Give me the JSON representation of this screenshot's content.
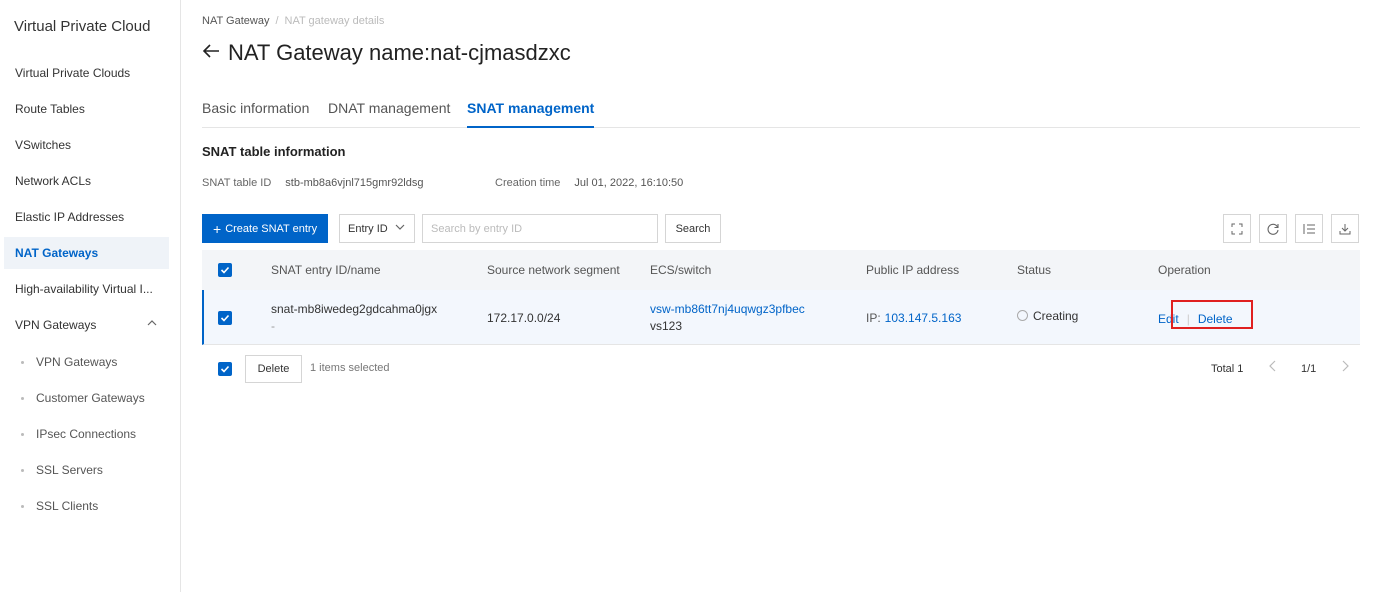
{
  "sidebar": {
    "title": "Virtual Private Cloud",
    "items": [
      {
        "label": "Virtual Private Clouds"
      },
      {
        "label": "Route Tables"
      },
      {
        "label": "VSwitches"
      },
      {
        "label": "Network ACLs"
      },
      {
        "label": "Elastic IP Addresses"
      },
      {
        "label": "NAT Gateways",
        "active": true
      },
      {
        "label": "High-availability Virtual I..."
      },
      {
        "label": "VPN Gateways",
        "expanded": true
      }
    ],
    "sub_items": [
      {
        "label": "VPN Gateways"
      },
      {
        "label": "Customer Gateways"
      },
      {
        "label": "IPsec Connections"
      },
      {
        "label": "SSL Servers"
      },
      {
        "label": "SSL Clients"
      }
    ]
  },
  "breadcrumb": {
    "parent": "NAT Gateway",
    "separator": "/",
    "current": "NAT gateway details"
  },
  "page": {
    "title": "NAT Gateway name:nat-cjmasdzxc"
  },
  "tabs": [
    {
      "label": "Basic information"
    },
    {
      "label": "DNAT management"
    },
    {
      "label": "SNAT management",
      "active": true
    }
  ],
  "snat": {
    "section_title": "SNAT table information",
    "table_id_label": "SNAT table ID",
    "table_id_value": "stb-mb8a6vjnl715gmr92ldsg",
    "creation_time_label": "Creation time",
    "creation_time_value": "Jul 01, 2022, 16:10:50"
  },
  "toolbar": {
    "create_label": "Create SNAT entry",
    "filter_select": "Entry ID",
    "search_placeholder": "Search by entry ID",
    "search_button": "Search"
  },
  "table": {
    "columns": [
      "SNAT entry ID/name",
      "Source network segment",
      "ECS/switch",
      "Public IP address",
      "Status",
      "Operation"
    ],
    "rows": [
      {
        "entry_id": "snat-mb8iwedeg2gdcahma0jgx",
        "entry_name": "-",
        "source_segment": "172.17.0.0/24",
        "switch_id": "vsw-mb86tt7nj4uqwgz3pfbec",
        "switch_name": "vs123",
        "ip_prefix": "IP:",
        "public_ip": "103.147.5.163",
        "status": "Creating",
        "op_edit": "Edit",
        "op_delete": "Delete",
        "selected": true
      }
    ]
  },
  "footer": {
    "delete_label": "Delete",
    "selected_text": "1 items selected",
    "total": "Total 1",
    "page_indicator": "1/1"
  },
  "colors": {
    "primary": "#0064c8",
    "highlight": "#e02020"
  }
}
